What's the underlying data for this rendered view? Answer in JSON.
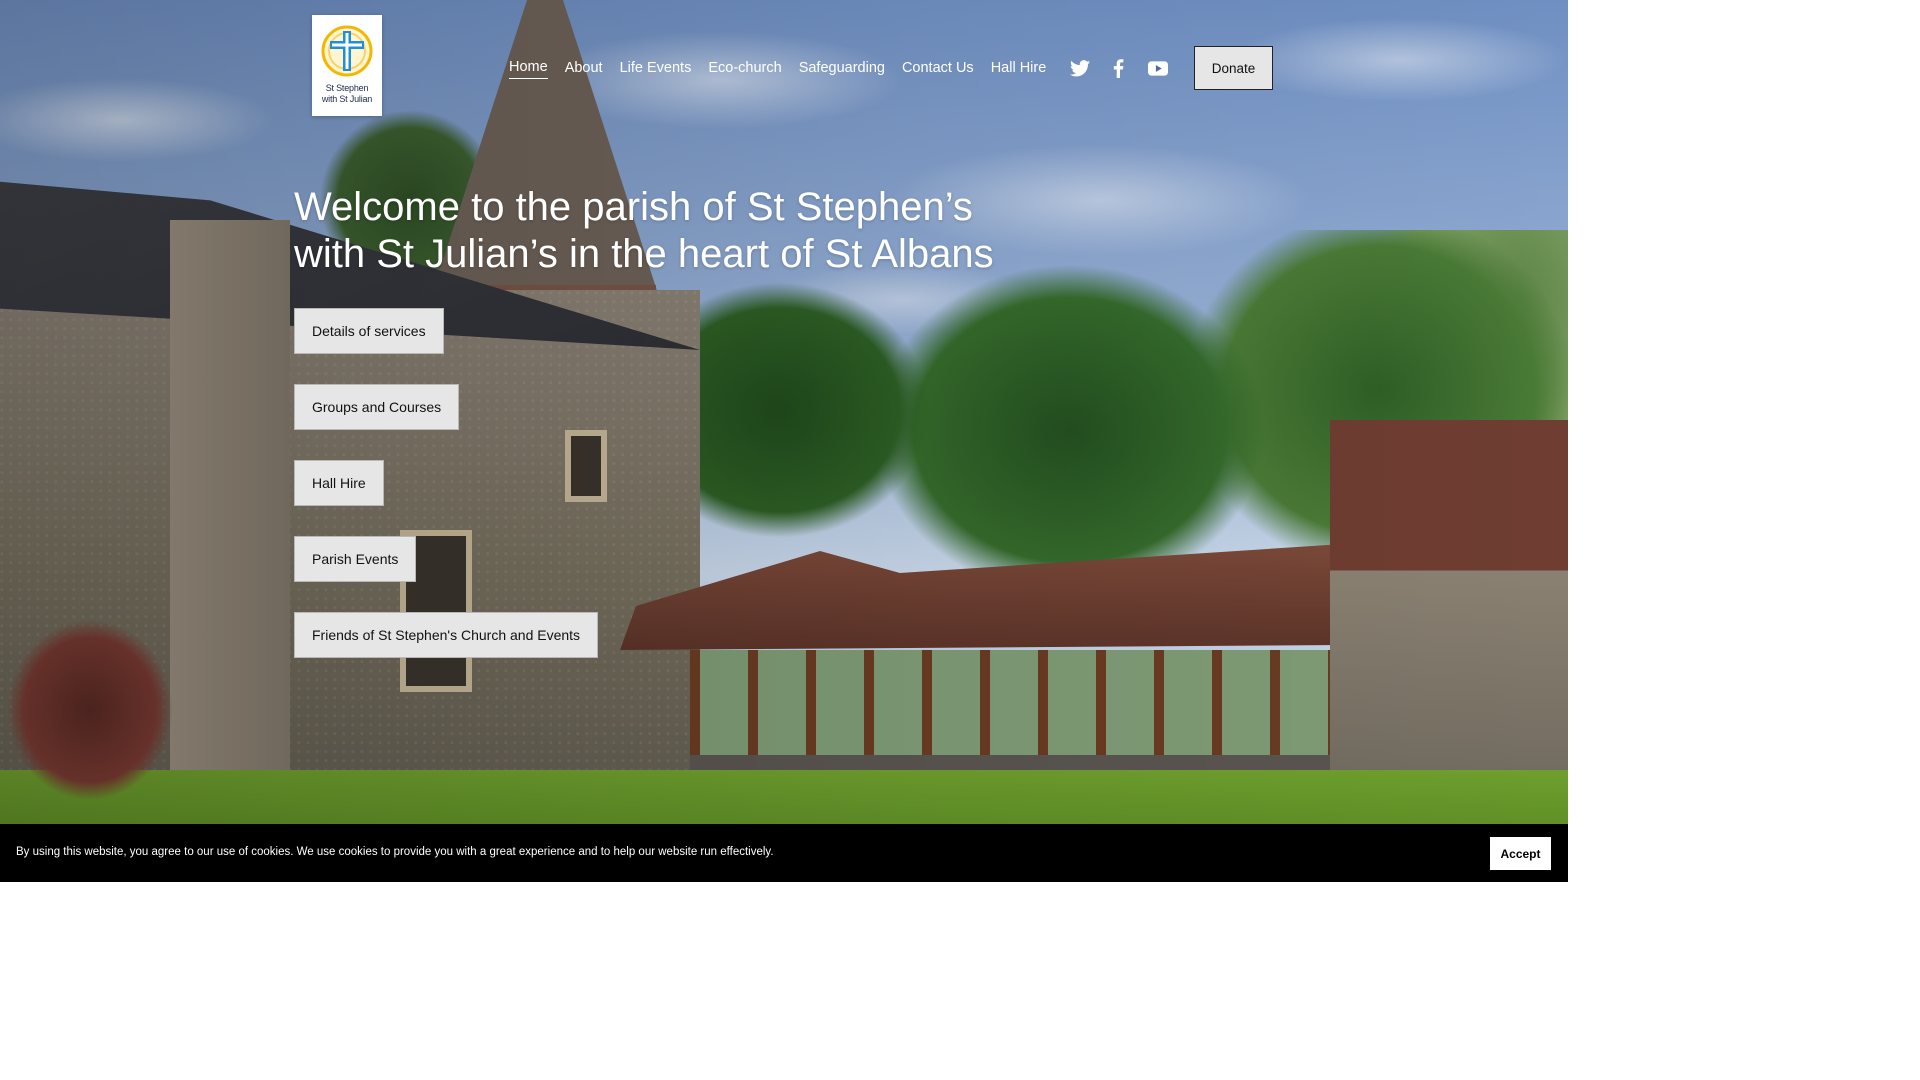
{
  "site": {
    "logo_line1": "St Stephen",
    "logo_line2": "with St Julian"
  },
  "nav": {
    "items": [
      {
        "label": "Home",
        "active": true
      },
      {
        "label": "About"
      },
      {
        "label": "Life Events"
      },
      {
        "label": "Eco-church"
      },
      {
        "label": "Safeguarding"
      },
      {
        "label": "Contact Us"
      },
      {
        "label": "Hall Hire"
      }
    ]
  },
  "social": [
    "twitter-icon",
    "facebook-icon",
    "youtube-icon"
  ],
  "header": {
    "donate_label": "Donate"
  },
  "hero": {
    "title": "Welcome to the parish of St Stephen’s with St Julian’s in the heart of St Albans",
    "buttons": [
      "Details of services",
      "Groups and Courses",
      "Hall Hire",
      "Parish Events",
      "Friends of St Stephen's Church and Events"
    ]
  },
  "cookie": {
    "text": "By using this website, you agree to our use of cookies. We use cookies to provide you with a great experience and to help our website run effectively.",
    "accept_label": "Accept"
  },
  "colors": {
    "logo_cross": "#1f8fd8",
    "logo_ring": "#f2b705",
    "button_bg": "#e6e6e6",
    "cookie_bg": "#000000"
  }
}
